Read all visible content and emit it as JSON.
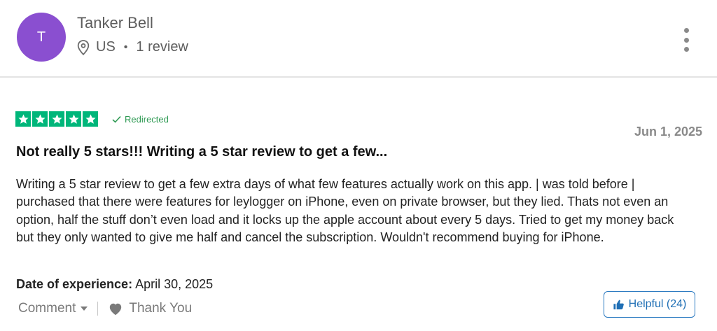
{
  "author": {
    "initial": "T",
    "name": "Tanker Bell",
    "location": "US",
    "separator": "•",
    "review_count": "1 review",
    "avatar_color": "#8a4fd0",
    "location_icon": "map-pin-icon",
    "more_icon": "more-vertical-icon"
  },
  "review": {
    "rating": 5,
    "star_color": "#00b67a",
    "redirected_label": "Redirected",
    "date": "Jun 1, 2025",
    "title": "Not really 5 stars!!! Writing a 5 star review to get a few...",
    "body": "Writing a 5 star review to get a few extra days of what few features actually work on this app. | was told before | purchased that there were features for leylogger on iPhone, even on private browser, but they lied. Thats not even an option, half the stuff don’t even load and it locks up the apple account about every 5 days. Tried to get my money back but they only wanted to give me half and cancel the subscription. Wouldn't recommend buying for iPhone.",
    "experience_label": "Date of experience:",
    "experience_date": "April 30, 2025"
  },
  "actions": {
    "comment_label": "Comment",
    "thank_label": "Thank You",
    "helpful_label": "Helpful (24)",
    "accent_color": "#1f6fb5"
  }
}
